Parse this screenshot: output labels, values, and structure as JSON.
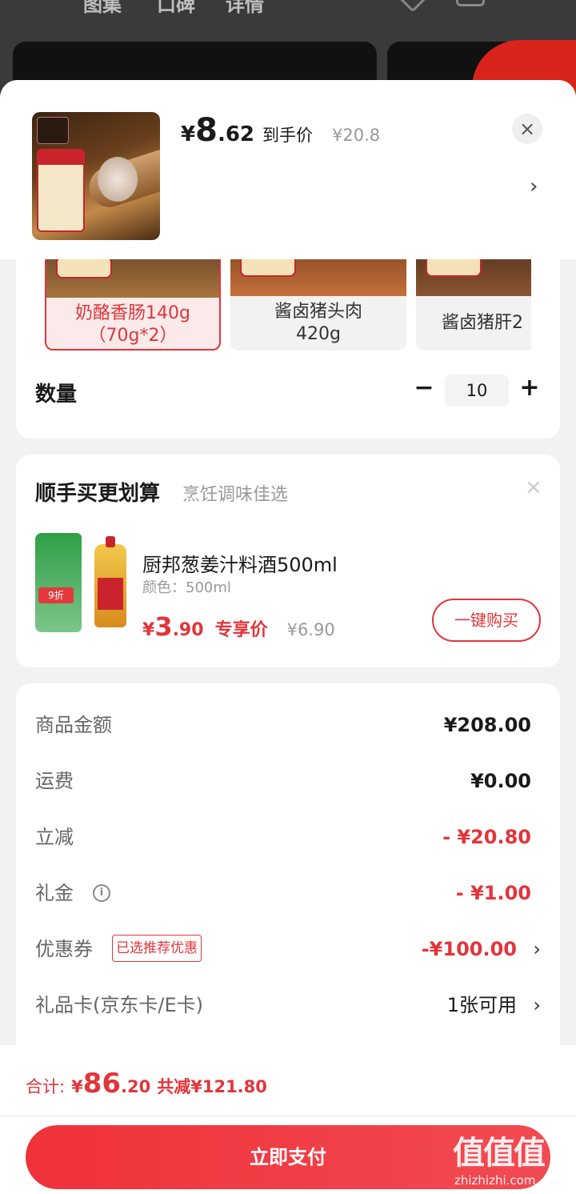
{
  "background": {
    "tabs": [
      "图集",
      "口碑",
      "详情"
    ]
  },
  "header": {
    "currency": "¥",
    "price_int": "8",
    "price_dec": ".62",
    "price_tag": "到手价",
    "orig_price": "¥20.8",
    "close": "×",
    "chevron": "›"
  },
  "options": [
    {
      "label": "奶酪香肠140g（70g*2）",
      "line1": "奶酪香肠140g",
      "line2": "（70g*2）",
      "selected": true
    },
    {
      "label": "酱卤猪头肉420g",
      "line1": "酱卤猪头肉",
      "line2": "420g",
      "selected": false
    },
    {
      "label": "酱卤猪肝2",
      "line1": "酱卤猪肝2",
      "line2": "",
      "selected": false
    }
  ],
  "quantity": {
    "label": "数量",
    "minus": "−",
    "value": "10",
    "plus": "+"
  },
  "addon": {
    "title": "顺手买更划算",
    "subtitle": "烹饪调味佳选",
    "close": "×",
    "discount_tag": "9折",
    "name": "厨邦葱姜汁料酒500ml",
    "spec": "颜色：500ml",
    "currency": "¥",
    "price_int": "3",
    "price_dec": ".90",
    "price_tag": "专享价",
    "orig_price": "¥6.90",
    "buy_label": "一键购买"
  },
  "summary": {
    "rows": [
      {
        "label": "商品金额",
        "value": "¥208.00"
      },
      {
        "label": "运费",
        "value": "¥0.00"
      },
      {
        "label": "立减",
        "value": "- ¥20.80"
      },
      {
        "label": "礼金",
        "value": "- ¥1.00"
      },
      {
        "label": "优惠券",
        "value": "-¥100.00",
        "badge": "已选推荐优惠"
      },
      {
        "label": "礼品卡(京东卡/E卡)",
        "value": "1张可用"
      }
    ],
    "info_icon": "i",
    "chevron": "›"
  },
  "footer": {
    "total_label": "合计:",
    "currency": "¥",
    "total_int": "86",
    "total_dec": ".20",
    "saved": "共减¥121.80",
    "pay_label": "立即支付"
  },
  "watermark": {
    "big": "值值值",
    "small": "zhizhizhi.com"
  },
  "colors": {
    "accent": "#e2353a",
    "selected_bg": "#fbeaea"
  }
}
